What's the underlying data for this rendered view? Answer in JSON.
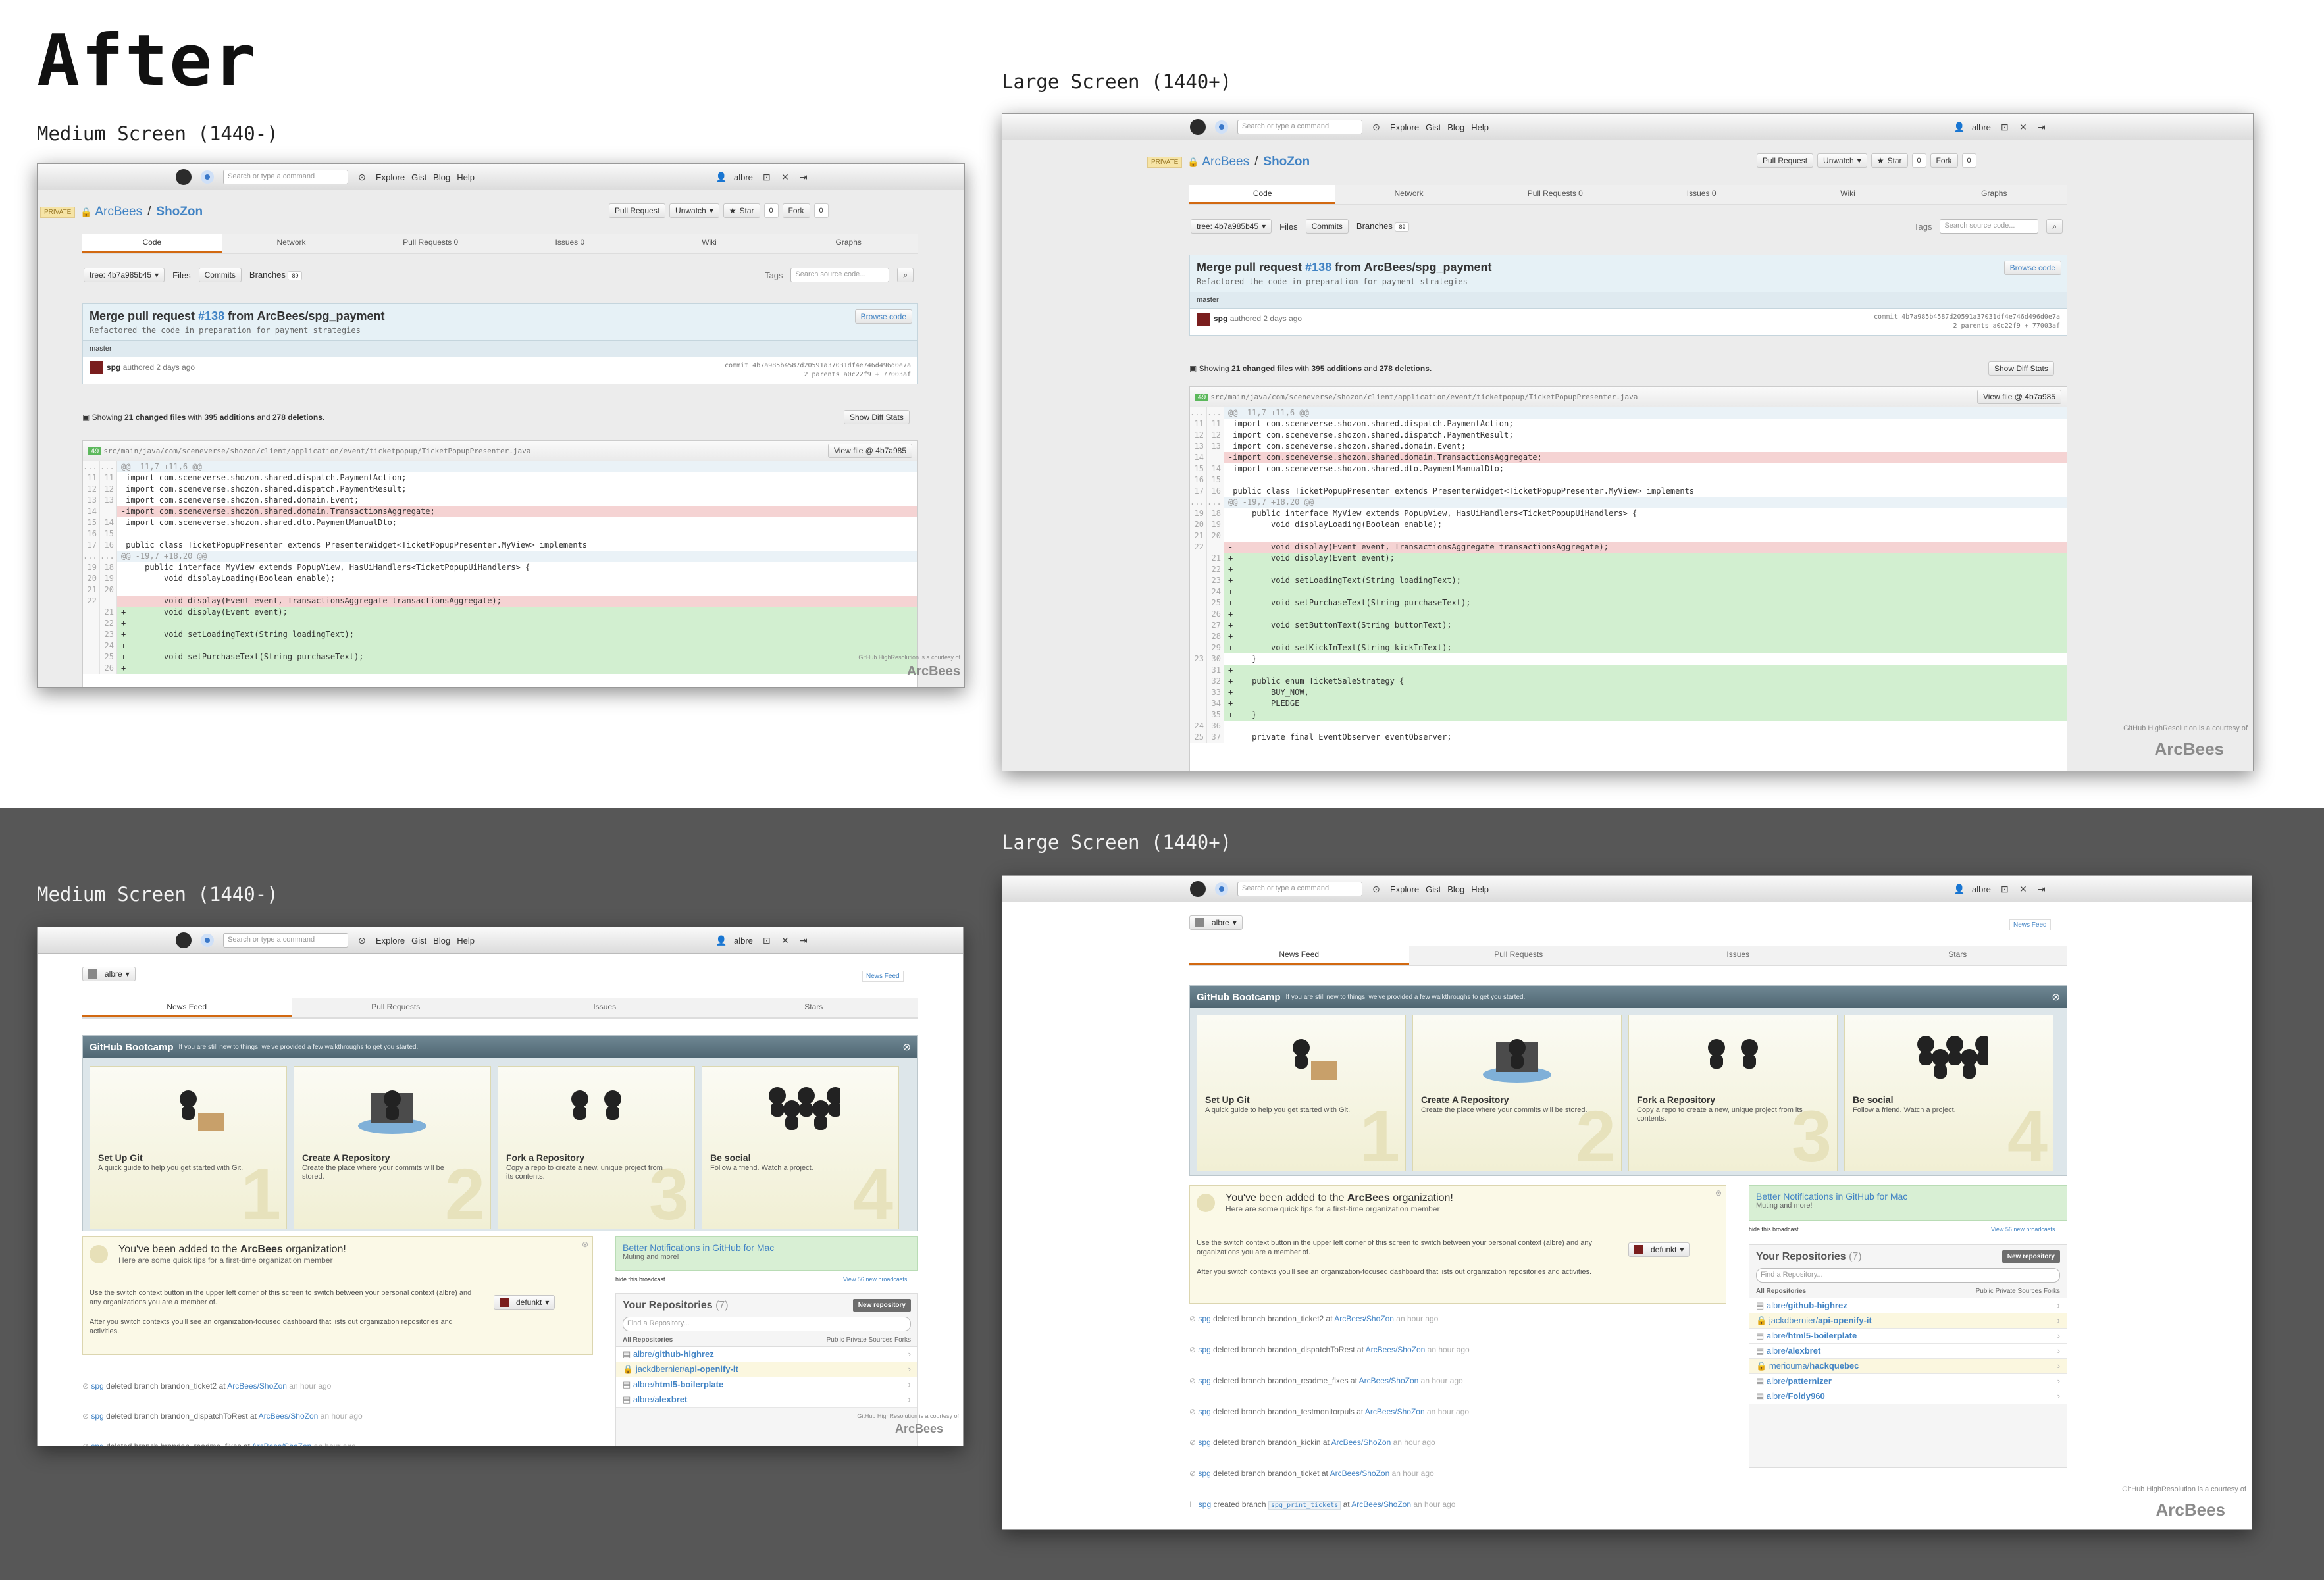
{
  "page_title": "After",
  "labels": {
    "medium_top": "Medium Screen (1440-)",
    "large_top": "Large Screen (1440+)",
    "medium_bottom": "Medium Screen (1440-)",
    "large_bottom": "Large Screen (1440+)"
  },
  "topbar": {
    "search_placeholder": "Search or type a command",
    "nav": [
      "Explore",
      "Gist",
      "Blog",
      "Help"
    ],
    "user": "albre"
  },
  "repo": {
    "private_badge": "PRIVATE",
    "owner": "ArcBees",
    "name": "ShoZon",
    "pull_request": "Pull Request",
    "unwatch": "Unwatch",
    "star": "Star",
    "star_count": "0",
    "fork": "Fork",
    "fork_count": "0",
    "tabs": [
      "Code",
      "Network",
      "Pull Requests  0",
      "Issues  0",
      "Wiki",
      "Graphs"
    ],
    "tree": "tree: 4b7a985b45",
    "files": "Files",
    "commits": "Commits",
    "branches": "Branches",
    "branches_count": "89",
    "tags": "Tags",
    "search_code": "Search source code..."
  },
  "commit": {
    "title_prefix": "Merge pull request",
    "pr": "#138",
    "title_suffix": "from ArcBees/spg_payment",
    "description": "Refactored the code in preparation for payment strategies",
    "browse": "Browse code",
    "branch": "master",
    "author": "spg",
    "authored": "authored 2 days ago",
    "commit_line": "commit 4b7a985b4587d20591a37031df4e746d496d0e7a",
    "parents_line": "2 parents a0c22f9 + 77003af",
    "summary_pre": "Showing",
    "summary_files": "21 changed files",
    "summary_mid": "with",
    "summary_add": "395 additions",
    "summary_and": "and",
    "summary_del": "278 deletions.",
    "show_diff": "Show Diff Stats",
    "file_count": "49",
    "file_path": "src/main/java/com/sceneverse/shozon/client/application/event/ticketpopup/TicketPopupPresenter.java",
    "view_file": "View file @ 4b7a985"
  },
  "diff_medium": [
    {
      "t": "hunk",
      "a": "...",
      "b": "...",
      "c": "@@ -11,7 +11,6 @@"
    },
    {
      "t": "ctx",
      "a": "11",
      "b": "11",
      "c": " import com.sceneverse.shozon.shared.dispatch.PaymentAction;"
    },
    {
      "t": "ctx",
      "a": "12",
      "b": "12",
      "c": " import com.sceneverse.shozon.shared.dispatch.PaymentResult;"
    },
    {
      "t": "ctx",
      "a": "13",
      "b": "13",
      "c": " import com.sceneverse.shozon.shared.domain.Event;"
    },
    {
      "t": "del",
      "a": "14",
      "b": "",
      "c": "-import com.sceneverse.shozon.shared.domain.TransactionsAggregate;"
    },
    {
      "t": "ctx",
      "a": "15",
      "b": "14",
      "c": " import com.sceneverse.shozon.shared.dto.PaymentManualDto;"
    },
    {
      "t": "ctx",
      "a": "16",
      "b": "15",
      "c": ""
    },
    {
      "t": "ctx",
      "a": "17",
      "b": "16",
      "c": " public class TicketPopupPresenter extends PresenterWidget<TicketPopupPresenter.MyView> implements"
    },
    {
      "t": "hunk",
      "a": "...",
      "b": "...",
      "c": "@@ -19,7 +18,20 @@"
    },
    {
      "t": "ctx",
      "a": "19",
      "b": "18",
      "c": "     public interface MyView extends PopupView, HasUiHandlers<TicketPopupUiHandlers> {"
    },
    {
      "t": "ctx",
      "a": "20",
      "b": "19",
      "c": "         void displayLoading(Boolean enable);"
    },
    {
      "t": "ctx",
      "a": "21",
      "b": "20",
      "c": ""
    },
    {
      "t": "del",
      "a": "22",
      "b": "",
      "c": "-        void display(Event event, TransactionsAggregate transactionsAggregate);"
    },
    {
      "t": "add",
      "a": "",
      "b": "21",
      "c": "+        void display(Event event);"
    },
    {
      "t": "add",
      "a": "",
      "b": "22",
      "c": "+"
    },
    {
      "t": "add",
      "a": "",
      "b": "23",
      "c": "+        void setLoadingText(String loadingText);"
    },
    {
      "t": "add",
      "a": "",
      "b": "24",
      "c": "+"
    },
    {
      "t": "add",
      "a": "",
      "b": "25",
      "c": "+        void setPurchaseText(String purchaseText);"
    },
    {
      "t": "add",
      "a": "",
      "b": "26",
      "c": "+"
    }
  ],
  "diff_large": [
    {
      "t": "hunk",
      "a": "...",
      "b": "...",
      "c": "@@ -11,7 +11,6 @@"
    },
    {
      "t": "ctx",
      "a": "11",
      "b": "11",
      "c": " import com.sceneverse.shozon.shared.dispatch.PaymentAction;"
    },
    {
      "t": "ctx",
      "a": "12",
      "b": "12",
      "c": " import com.sceneverse.shozon.shared.dispatch.PaymentResult;"
    },
    {
      "t": "ctx",
      "a": "13",
      "b": "13",
      "c": " import com.sceneverse.shozon.shared.domain.Event;"
    },
    {
      "t": "del",
      "a": "14",
      "b": "",
      "c": "-import com.sceneverse.shozon.shared.domain.TransactionsAggregate;"
    },
    {
      "t": "ctx",
      "a": "15",
      "b": "14",
      "c": " import com.sceneverse.shozon.shared.dto.PaymentManualDto;"
    },
    {
      "t": "ctx",
      "a": "16",
      "b": "15",
      "c": ""
    },
    {
      "t": "ctx",
      "a": "17",
      "b": "16",
      "c": " public class TicketPopupPresenter extends PresenterWidget<TicketPopupPresenter.MyView> implements"
    },
    {
      "t": "hunk",
      "a": "...",
      "b": "...",
      "c": "@@ -19,7 +18,20 @@"
    },
    {
      "t": "ctx",
      "a": "19",
      "b": "18",
      "c": "     public interface MyView extends PopupView, HasUiHandlers<TicketPopupUiHandlers> {"
    },
    {
      "t": "ctx",
      "a": "20",
      "b": "19",
      "c": "         void displayLoading(Boolean enable);"
    },
    {
      "t": "ctx",
      "a": "21",
      "b": "20",
      "c": ""
    },
    {
      "t": "del",
      "a": "22",
      "b": "",
      "c": "-        void display(Event event, TransactionsAggregate transactionsAggregate);"
    },
    {
      "t": "add",
      "a": "",
      "b": "21",
      "c": "+        void display(Event event);"
    },
    {
      "t": "add",
      "a": "",
      "b": "22",
      "c": "+"
    },
    {
      "t": "add",
      "a": "",
      "b": "23",
      "c": "+        void setLoadingText(String loadingText);"
    },
    {
      "t": "add",
      "a": "",
      "b": "24",
      "c": "+"
    },
    {
      "t": "add",
      "a": "",
      "b": "25",
      "c": "+        void setPurchaseText(String purchaseText);"
    },
    {
      "t": "add",
      "a": "",
      "b": "26",
      "c": "+"
    },
    {
      "t": "add",
      "a": "",
      "b": "27",
      "c": "+        void setButtonText(String buttonText);"
    },
    {
      "t": "add",
      "a": "",
      "b": "28",
      "c": "+"
    },
    {
      "t": "add",
      "a": "",
      "b": "29",
      "c": "+        void setKickInText(String kickInText);"
    },
    {
      "t": "ctx",
      "a": "23",
      "b": "30",
      "c": "     }"
    },
    {
      "t": "add",
      "a": "",
      "b": "31",
      "c": "+"
    },
    {
      "t": "add",
      "a": "",
      "b": "32",
      "c": "+    public enum TicketSaleStrategy {"
    },
    {
      "t": "add",
      "a": "",
      "b": "33",
      "c": "+        BUY_NOW,"
    },
    {
      "t": "add",
      "a": "",
      "b": "34",
      "c": "+        PLEDGE"
    },
    {
      "t": "add",
      "a": "",
      "b": "35",
      "c": "+    }"
    },
    {
      "t": "ctx",
      "a": "24",
      "b": "36",
      "c": ""
    },
    {
      "t": "ctx",
      "a": "25",
      "b": "37",
      "c": "     private final EventObserver eventObserver;"
    }
  ],
  "courtesy": "GitHub HighResolution is a courtesy of",
  "arcbees": "ArcBees",
  "dashboard": {
    "account": "albre",
    "news_feed_link": "News Feed",
    "tabs": [
      "News Feed",
      "Pull Requests",
      "Issues",
      "Stars"
    ],
    "bootcamp_title": "GitHub Bootcamp",
    "bootcamp_sub": "If you are still new to things, we've provided a few walkthroughs to get you started.",
    "cards": [
      {
        "title": "Set Up Git",
        "desc": "A quick guide to help you get started with Git.",
        "num": "1"
      },
      {
        "title": "Create A Repository",
        "desc": "Create the place where your commits will be stored.",
        "num": "2"
      },
      {
        "title": "Fork a Repository",
        "desc": "Copy a repo to create a new, unique project from its contents.",
        "num": "3"
      },
      {
        "title": "Be social",
        "desc": "Follow a friend. Watch a project.",
        "num": "4"
      }
    ],
    "org_pre": "You've been added to the",
    "org_name": "ArcBees",
    "org_post": "organization!",
    "org_tips": "Here are some quick tips for a first-time organization member",
    "org_p1": "Use the switch context button in the upper left corner of this screen to switch between your personal context (albre) and any organizations you are a member of.",
    "org_p2": "After you switch contexts you'll see an organization-focused dashboard that lists out organization repositories and activities.",
    "switch_user": "defunkt",
    "bn_title": "Better Notifications in GitHub for Mac",
    "bn_sub": "Muting and more!",
    "hide_broadcast": "hide this broadcast",
    "view_broadcasts": "View 56 new broadcasts",
    "your_repos": "Your Repositories",
    "repo_count": "(7)",
    "new_repo": "New repository",
    "find_repo": "Find a Repository...",
    "filters": [
      "All Repositories",
      "Public",
      "Private",
      "Sources",
      "Forks"
    ],
    "repos": [
      {
        "owner": "albre/",
        "name": "github-highrez",
        "priv": false
      },
      {
        "owner": "jackdbernier/",
        "name": "api-openify-it",
        "priv": true
      },
      {
        "owner": "albre/",
        "name": "html5-boilerplate",
        "priv": false
      },
      {
        "owner": "albre/",
        "name": "alexbret",
        "priv": false
      },
      {
        "owner": "meriouma/",
        "name": "hackquebec",
        "priv": true
      },
      {
        "owner": "albre/",
        "name": "patternizer",
        "priv": false
      },
      {
        "owner": "albre/",
        "name": "Foldy960",
        "priv": false
      }
    ],
    "events": [
      {
        "user": "spg",
        "act": "deleted branch brandon_ticket2 at",
        "repo": "ArcBees/ShoZon",
        "time": "an hour ago"
      },
      {
        "user": "spg",
        "act": "deleted branch brandon_dispatchToRest at",
        "repo": "ArcBees/ShoZon",
        "time": "an hour ago"
      },
      {
        "user": "spg",
        "act": "deleted branch brandon_readme_fixes at",
        "repo": "ArcBees/ShoZon",
        "time": "an hour ago"
      },
      {
        "user": "spg",
        "act": "deleted branch brandon_testmonitorpuls at",
        "repo": "ArcBees/ShoZon",
        "time": "an hour ago"
      },
      {
        "user": "spg",
        "act": "deleted branch brandon_kickin at",
        "repo": "ArcBees/ShoZon",
        "time": "an hour ago"
      },
      {
        "user": "spg",
        "act": "deleted branch brandon_ticket at",
        "repo": "ArcBees/ShoZon",
        "time": "an hour ago"
      },
      {
        "user": "spg",
        "act": "created branch",
        "branch": "spg_print_tickets",
        "act2": "at",
        "repo": "ArcBees/ShoZon",
        "time": "an hour ago"
      }
    ]
  },
  "colors": {
    "accent": "#d26911",
    "link": "#4183c4",
    "dark_band": "#575757"
  }
}
